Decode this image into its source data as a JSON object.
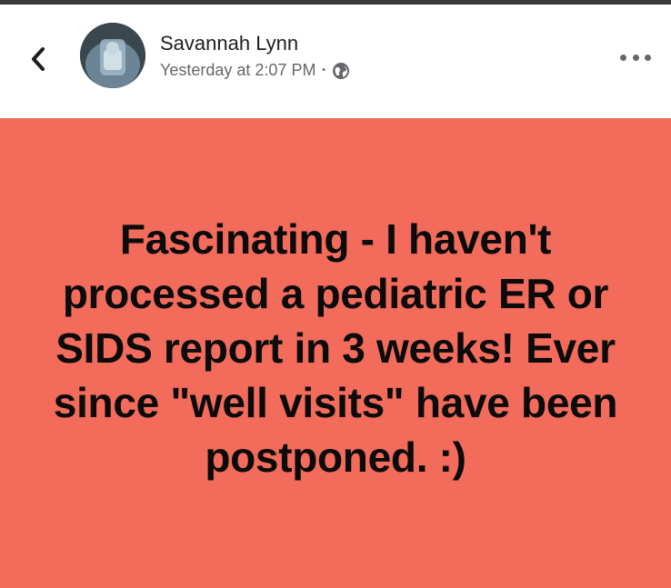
{
  "post": {
    "author_name": "Savannah Lynn",
    "timestamp": "Yesterday at 2:07 PM",
    "separator": "·",
    "privacy_icon": "globe-icon",
    "back_icon": "chevron-left-icon",
    "more_icon": "more-horizontal-icon",
    "background_color": "#f26b5b",
    "text": "Fascinating - I haven't processed a pediatric ER or SIDS report in 3 weeks! Ever since \"well visits\" have been postponed.  :)"
  }
}
